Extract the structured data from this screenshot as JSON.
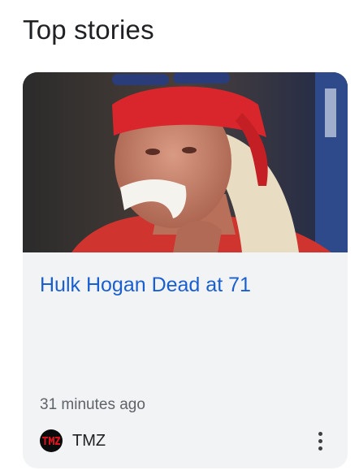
{
  "section": {
    "title": "Top stories"
  },
  "story": {
    "headline": "Hulk Hogan Dead at 71",
    "timestamp": "31 minutes ago",
    "source": {
      "name": "TMZ",
      "logo_icon": "tmz-logo-icon"
    },
    "image_icon": "news-photo-image",
    "more_icon": "more-vert-icon"
  },
  "colors": {
    "headline": "#1a5fd0",
    "card_background": "#f1f3f4",
    "title_text": "#202124",
    "meta_text": "#5f6368",
    "bandana_red": "#d9262c"
  }
}
